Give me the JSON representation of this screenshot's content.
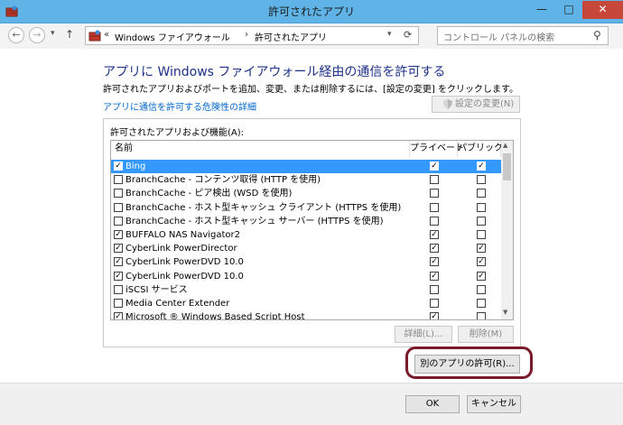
{
  "window": {
    "title": "許可されたアプリ",
    "controls": {
      "minimize": "—",
      "maximize": "□",
      "close": "✕"
    }
  },
  "nav": {
    "back_icon": "←",
    "forward_icon": "→",
    "dropdown_icon": "▾",
    "up_icon": "↑",
    "breadcrumb": [
      "«",
      "Windows ファイアウォール",
      "›",
      "許可されたアプリ"
    ],
    "address_dropdown_icon": "▾",
    "refresh_icon": "⟳",
    "search_placeholder": "コントロール パネルの検索",
    "search_icon": "⚲"
  },
  "main": {
    "heading": "アプリに Windows ファイアウォール経由の通信を許可する",
    "description": "許可されたアプリおよびポートを追加、変更、または削除するには、[設定の変更] をクリックします。",
    "risk_link": "アプリに通信を許可する危険性の詳細",
    "change_settings": "設定の変更(N)",
    "change_settings_icon": "shield-icon"
  },
  "list": {
    "label": "許可されたアプリおよび機能(A):",
    "columns": [
      "名前",
      "プライベート",
      "パブリック"
    ],
    "rows": [
      {
        "name": "Bing",
        "enabled": true,
        "private": true,
        "public": true,
        "selected": true
      },
      {
        "name": "BranchCache - コンテンツ取得 (HTTP を使用)",
        "enabled": false,
        "private": false,
        "public": false
      },
      {
        "name": "BranchCache - ピア検出 (WSD を使用)",
        "enabled": false,
        "private": false,
        "public": false
      },
      {
        "name": "BranchCache - ホスト型キャッシュ クライアント (HTTPS を使用)",
        "enabled": false,
        "private": false,
        "public": false
      },
      {
        "name": "BranchCache - ホスト型キャッシュ サーバー (HTTPS を使用)",
        "enabled": false,
        "private": false,
        "public": false
      },
      {
        "name": "BUFFALO NAS Navigator2",
        "enabled": true,
        "private": true,
        "public": false
      },
      {
        "name": "CyberLink PowerDirector",
        "enabled": true,
        "private": true,
        "public": true
      },
      {
        "name": "CyberLink PowerDVD 10.0",
        "enabled": true,
        "private": true,
        "public": true
      },
      {
        "name": "CyberLink PowerDVD 10.0",
        "enabled": true,
        "private": true,
        "public": true
      },
      {
        "name": "iSCSI サービス",
        "enabled": false,
        "private": false,
        "public": false
      },
      {
        "name": "Media Center Extender",
        "enabled": false,
        "private": false,
        "public": false
      },
      {
        "name": "Microsoft ® Windows Based Script Host",
        "enabled": true,
        "private": true,
        "public": false
      }
    ],
    "scroll_up": "▲",
    "scroll_down": "▼",
    "details_button": "詳細(L)...",
    "remove_button": "削除(M)"
  },
  "allow_another_app": "別のアプリの許可(R)...",
  "footer": {
    "ok": "OK",
    "cancel": "キャンセル"
  }
}
